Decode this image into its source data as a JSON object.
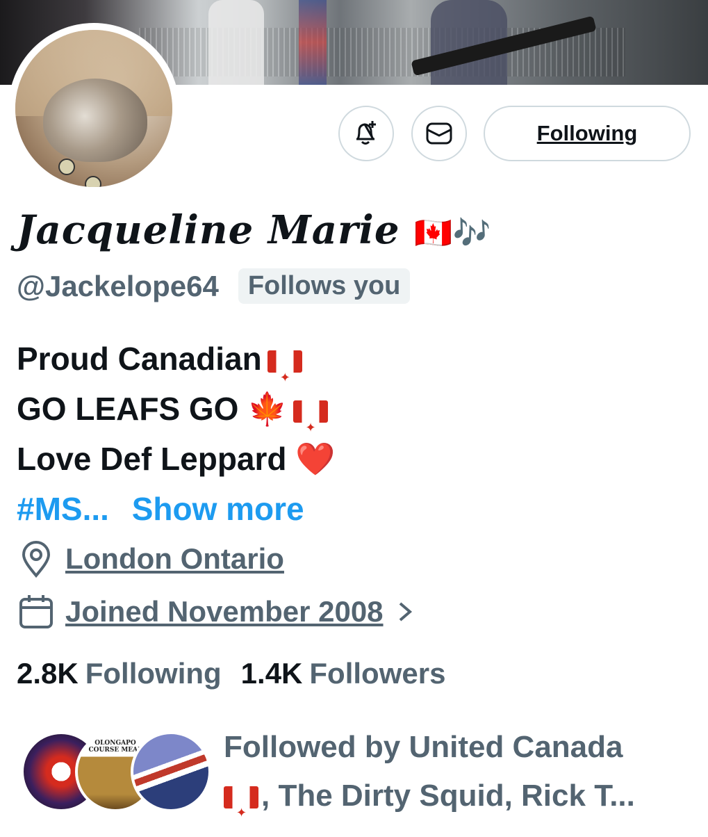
{
  "profile": {
    "display_name": "Jacqueline Marie",
    "display_name_emoji": "🇨🇦🎶",
    "handle": "@Jackelope64",
    "follows_you_badge": "Follows you"
  },
  "actions": {
    "notify_icon": "bell-plus-icon",
    "message_icon": "envelope-icon",
    "following_label": "Following"
  },
  "bio": {
    "line1": "Proud Canadian",
    "line2": "GO LEAFS GO",
    "line2_emoji": "🍁",
    "line3": "Love Def Leppard",
    "line3_emoji": "❤️",
    "hashtag": "#MS...",
    "show_more": "Show more"
  },
  "meta": {
    "location": "London Ontario",
    "joined": "Joined November 2008"
  },
  "stats": {
    "following_count": "2.8K",
    "following_label": "Following",
    "followers_count": "1.4K",
    "followers_label": "Followers"
  },
  "followed_by": {
    "prefix": "Followed by United Canada",
    "rest": ", The Dirty Squid, Rick T...",
    "avatar_text": "OLONGAPO COURSE MEAL"
  },
  "colors": {
    "accent": "#1d9bf0",
    "secondary_text": "#536471",
    "border": "#cfd9de",
    "badge_bg": "#eff3f4"
  }
}
